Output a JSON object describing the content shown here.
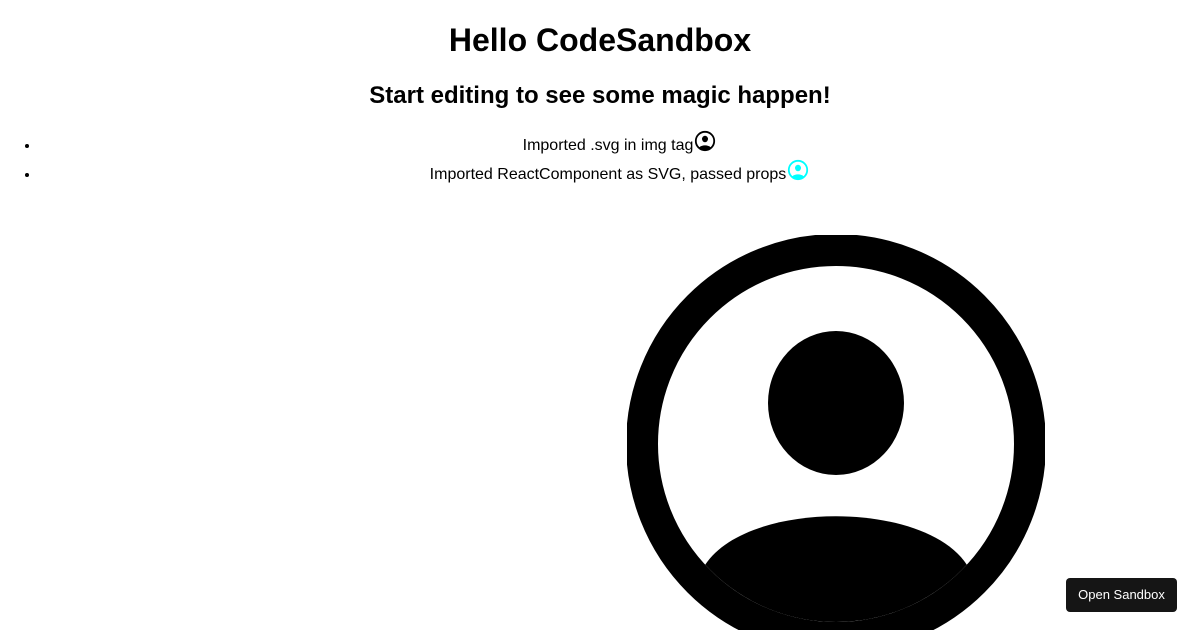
{
  "header": {
    "title": "Hello CodeSandbox",
    "subtitle": "Start editing to see some magic happen!"
  },
  "list": {
    "items": [
      {
        "label": "Imported .svg in img tag",
        "icon": "user-circle-icon",
        "icon_color": "#000000"
      },
      {
        "label": "Imported ReactComponent as SVG, passed props",
        "icon": "user-circle-icon",
        "icon_color": "#00ffff"
      }
    ]
  },
  "avatar": {
    "icon": "user-circle-icon",
    "color": "#000000"
  },
  "footer": {
    "open_sandbox_label": "Open Sandbox"
  }
}
